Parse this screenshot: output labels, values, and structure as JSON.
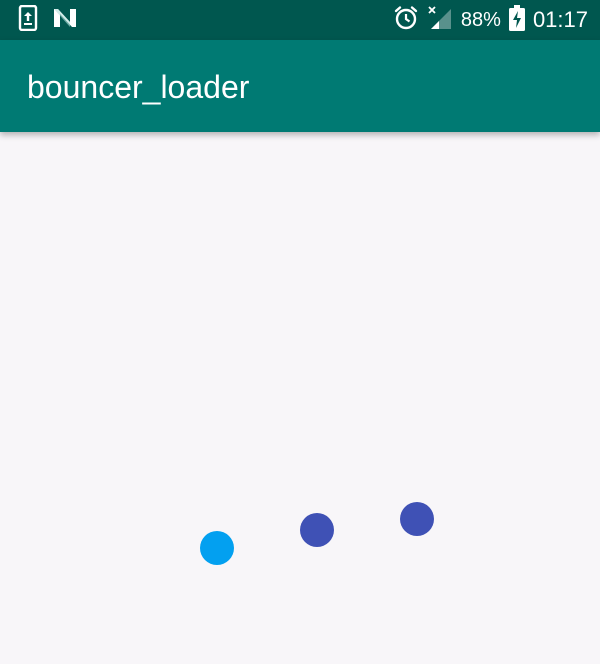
{
  "status_bar": {
    "icons_left": [
      "screen-share-icon",
      "notification-n-icon"
    ],
    "icons_right": [
      "alarm-icon",
      "signal-no-service-icon",
      "battery-charging-icon"
    ],
    "battery": "88%",
    "time": "01:17"
  },
  "app_bar": {
    "title": "bouncer_loader"
  },
  "loader": {
    "dot_count": 3,
    "colors": [
      "#03a0f0",
      "#3f51b5",
      "#3f51b5"
    ]
  }
}
